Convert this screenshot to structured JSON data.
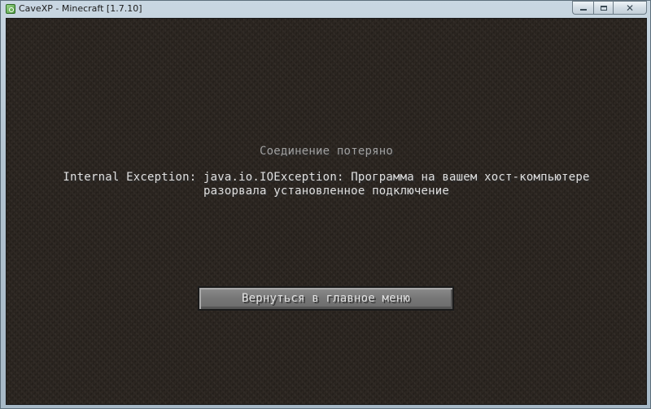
{
  "window": {
    "title": "CaveXP - Minecraft [1.7.10]",
    "icon": "minecraft-launcher-icon",
    "controls": {
      "minimize": "minimize-icon",
      "maximize": "maximize-icon",
      "close": "close-icon",
      "close_glyph": "✕"
    }
  },
  "screen": {
    "heading": "Соединение потеряно",
    "message_line1": "Internal Exception: java.io.IOException: Программа на вашем хост-компьютере",
    "message_line2": "разорвала установленное подключение",
    "button_label": "Вернуться в главное меню"
  },
  "colors": {
    "heading_text": "#a0a0a0",
    "message_text": "#e0e0e0",
    "button_face": "#767676",
    "background": "#2b2520"
  }
}
